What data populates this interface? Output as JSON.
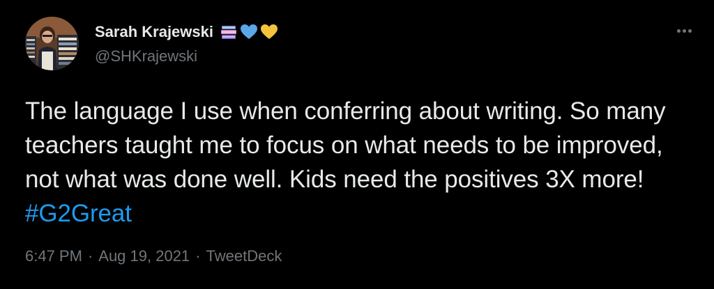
{
  "author": {
    "display_name": "Sarah Krajewski",
    "handle": "@SHKrajewski",
    "name_emojis": [
      "books-emoji",
      "blue-heart-emoji",
      "yellow-heart-emoji"
    ]
  },
  "tweet": {
    "text": "The language I use when conferring about writing. So many teachers taught me to focus on what needs to be improved, not what was done well. Kids need the positives 3X more!",
    "hashtag": "#G2Great",
    "time": "6:47 PM",
    "date": "Aug 19, 2021",
    "source": "TweetDeck",
    "separator": "·"
  },
  "colors": {
    "background": "#000000",
    "primary_text": "#e7e9ea",
    "secondary_text": "#71767b",
    "link": "#1d9bf0",
    "blue_heart": "#5aa7e8",
    "yellow_heart": "#f5c33b"
  },
  "icons": {
    "more": "more-options-icon"
  }
}
